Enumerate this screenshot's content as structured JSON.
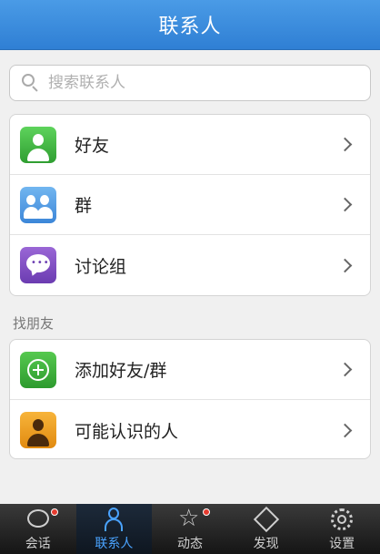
{
  "header": {
    "title": "联系人"
  },
  "search": {
    "placeholder": "搜索联系人",
    "value": ""
  },
  "contacts": {
    "items": [
      {
        "label": "好友",
        "icon": "friend-icon"
      },
      {
        "label": "群",
        "icon": "group-icon"
      },
      {
        "label": "讨论组",
        "icon": "discussion-icon"
      }
    ]
  },
  "find_friends": {
    "header": "找朋友",
    "items": [
      {
        "label": "添加好友/群",
        "icon": "add-icon"
      },
      {
        "label": "可能认识的人",
        "icon": "person-icon"
      }
    ]
  },
  "tabbar": {
    "tabs": [
      {
        "label": "会话",
        "icon": "chat-icon",
        "badge": true
      },
      {
        "label": "联系人",
        "icon": "contacts-icon",
        "active": true
      },
      {
        "label": "动态",
        "icon": "star-icon",
        "badge": true
      },
      {
        "label": "发现",
        "icon": "discover-icon"
      },
      {
        "label": "设置",
        "icon": "settings-icon"
      }
    ]
  },
  "colors": {
    "header": "#3a8ddc",
    "active_tab": "#4aa3ff",
    "badge": "#e53b2f"
  }
}
